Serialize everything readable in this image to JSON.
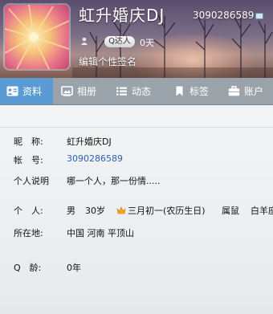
{
  "profile": {
    "nickname": "虹升婚庆DJ",
    "qq_number": "3090286589",
    "level_label": "Q达人",
    "days_label": "0天",
    "signature_prompt": "编辑个性签名"
  },
  "tabs": [
    {
      "label": "资料",
      "icon": "profile-card-icon",
      "active": true
    },
    {
      "label": "相册",
      "icon": "photo-album-icon",
      "active": false
    },
    {
      "label": "动态",
      "icon": "feed-list-icon",
      "active": false
    },
    {
      "label": "标签",
      "icon": "bookmark-icon",
      "active": false
    },
    {
      "label": "账户",
      "icon": "briefcase-icon",
      "active": false
    }
  ],
  "info": {
    "nickname_label": "昵　称:",
    "nickname_value": "虹升婚庆DJ",
    "account_label": "帐　号:",
    "account_value": "3090286589",
    "bio_label": "个人说明",
    "bio_value": "哪一个人，那一份情.....",
    "personal_label": "个　人:",
    "gender": "男",
    "age": "30岁",
    "birthday": "三月初一(农历生日)",
    "zodiac": "属鼠",
    "constellation": "白羊座",
    "location_label": "所在地:",
    "location_value": "中国 河南 平顶山",
    "qage_label": "Q　龄:",
    "qage_value": "0年"
  },
  "colors": {
    "tab_bar": "#9aa3aa",
    "active_tab": "#5b9bd5",
    "link_blue": "#2a62b6"
  }
}
